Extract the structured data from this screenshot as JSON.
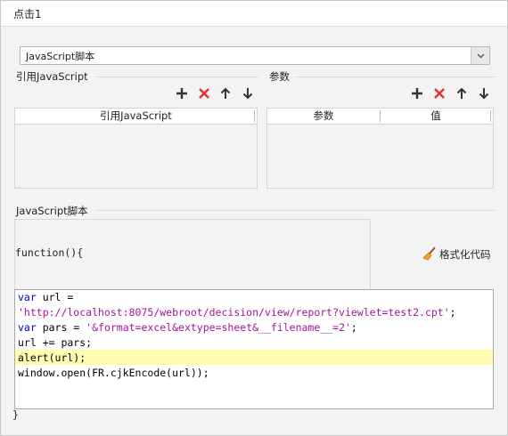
{
  "title": "点击1",
  "dropdown": {
    "value": "JavaScript脚本"
  },
  "ref_js": {
    "label": "引用JavaScript",
    "col_header": "引用JavaScript"
  },
  "params": {
    "label": "参数",
    "col_param": "参数",
    "col_value": "值"
  },
  "script_label": "JavaScript脚本",
  "func_open": "function(){",
  "format_button": "格式化代码",
  "code": {
    "l1_kw": "var",
    "l1_rest": " url =",
    "l2_str": "'http://localhost:8075/webroot/decision/view/report?viewlet=test2.cpt'",
    "l2_end": ";",
    "l3_kw": "var",
    "l3_mid": " pars = ",
    "l3_str": "'&format=excel&extype=sheet&__filename__=2'",
    "l3_end": ";",
    "l4": "url += pars;",
    "l5": "alert(url);",
    "l6": "window.open(FR.cjkEncode(url));"
  },
  "func_close": "}",
  "colors": {
    "add": "#333333",
    "delete": "#e03030",
    "keyword": "#0000cc",
    "string": "#a3159a",
    "highlight": "#fffbb0"
  },
  "icons": [
    "chevron-down-icon",
    "add-icon",
    "delete-icon",
    "move-up-icon",
    "move-down-icon",
    "broom-icon"
  ]
}
